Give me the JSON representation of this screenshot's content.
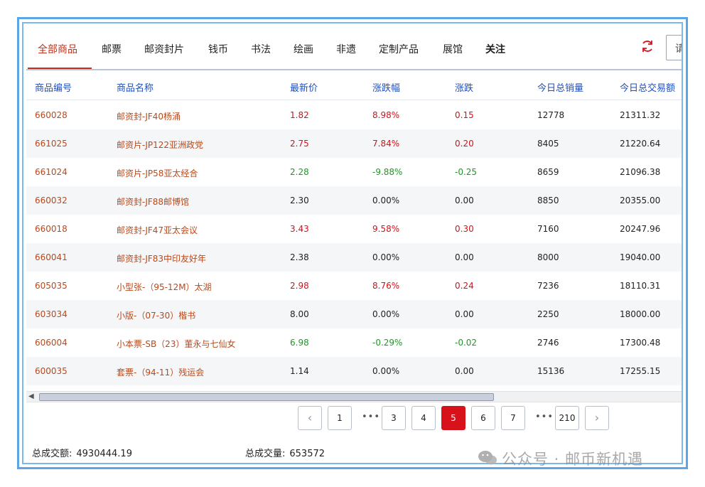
{
  "tabs": [
    {
      "label": "全部商品",
      "active": true
    },
    {
      "label": "邮票"
    },
    {
      "label": "邮资封片"
    },
    {
      "label": "钱币"
    },
    {
      "label": "书法"
    },
    {
      "label": "绘画"
    },
    {
      "label": "非遗"
    },
    {
      "label": "定制产品"
    },
    {
      "label": "展馆"
    },
    {
      "label": "关注"
    }
  ],
  "search": {
    "partial_text": "请"
  },
  "columns": [
    "商品编号",
    "商品名称",
    "最新价",
    "涨跌幅",
    "涨跌",
    "今日总销量",
    "今日总交易额"
  ],
  "rows": [
    {
      "code": "660028",
      "name": "邮资封-JF40杨涌",
      "price": "1.82",
      "pct": "8.98%",
      "change": "0.15",
      "volume": "12778",
      "amount": "21311.32",
      "trend": "up"
    },
    {
      "code": "661025",
      "name": "邮资片-JP122亚洲政党",
      "price": "2.75",
      "pct": "7.84%",
      "change": "0.20",
      "volume": "8405",
      "amount": "21220.64",
      "trend": "up"
    },
    {
      "code": "661024",
      "name": "邮资片-JP58亚太经合",
      "price": "2.28",
      "pct": "-9.88%",
      "change": "-0.25",
      "volume": "8659",
      "amount": "21096.38",
      "trend": "down"
    },
    {
      "code": "660032",
      "name": "邮资封-JF88邮博馆",
      "price": "2.30",
      "pct": "0.00%",
      "change": "0.00",
      "volume": "8850",
      "amount": "20355.00",
      "trend": "flat"
    },
    {
      "code": "660018",
      "name": "邮资封-JF47亚太会议",
      "price": "3.43",
      "pct": "9.58%",
      "change": "0.30",
      "volume": "7160",
      "amount": "20247.96",
      "trend": "up"
    },
    {
      "code": "660041",
      "name": "邮资封-JF83中印友好年",
      "price": "2.38",
      "pct": "0.00%",
      "change": "0.00",
      "volume": "8000",
      "amount": "19040.00",
      "trend": "flat"
    },
    {
      "code": "605035",
      "name": "小型张-（95-12M）太湖",
      "price": "2.98",
      "pct": "8.76%",
      "change": "0.24",
      "volume": "7236",
      "amount": "18110.31",
      "trend": "up"
    },
    {
      "code": "603034",
      "name": "小版-（07-30）楷书",
      "price": "8.00",
      "pct": "0.00%",
      "change": "0.00",
      "volume": "2250",
      "amount": "18000.00",
      "trend": "flat"
    },
    {
      "code": "606004",
      "name": "小本票-SB（23）董永与七仙女",
      "price": "6.98",
      "pct": "-0.29%",
      "change": "-0.02",
      "volume": "2746",
      "amount": "17300.48",
      "trend": "down"
    },
    {
      "code": "600035",
      "name": "套票-（94-11）残运会",
      "price": "1.14",
      "pct": "0.00%",
      "change": "0.00",
      "volume": "15136",
      "amount": "17255.15",
      "trend": "flat"
    }
  ],
  "pagination": {
    "pages": [
      "1",
      "3",
      "4",
      "5",
      "6",
      "7",
      "210"
    ],
    "current": "5",
    "ellipsis": "•••",
    "prev": "‹",
    "next": "›"
  },
  "footer": {
    "total_amount_label": "总成交额:",
    "total_amount": "4930444.19",
    "total_volume_label": "总成交量:",
    "total_volume": "653572"
  },
  "watermark": "公众号 · 邮币新机遇",
  "colors": {
    "up": "#d0121b",
    "down": "#1c9a23",
    "accent": "#c0301c",
    "header": "#1f4fbf",
    "frame": "#5aa6e6"
  }
}
